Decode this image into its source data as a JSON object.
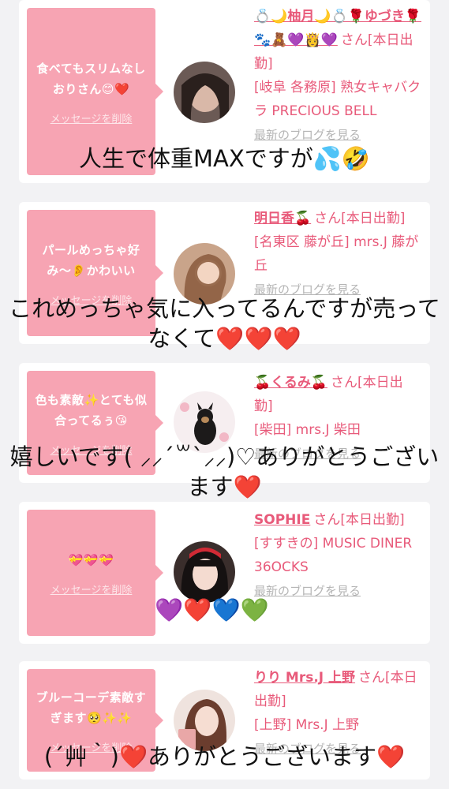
{
  "cards": [
    {
      "message": "食べてもスリムなしおりさん😊❤️",
      "delete_label": "メッセージを削除",
      "name": "💍🌙柚月🌙💍🌹ゆづき🌹🐾🧸💜👸💜",
      "suffix": "さん[本日出勤]",
      "shop": "[岐阜 各務原] 熟女キャバクラ PRECIOUS BELL",
      "blog_link": "最新のブログを見る"
    },
    {
      "message": "パールめっちゃ好み〜👂かわいい",
      "delete_label": "メッセージを削除",
      "name": "明日香🍒",
      "suffix": "さん[本日出勤]",
      "shop": "[名東区 藤が丘] mrs.J 藤が丘",
      "blog_link": "最新のブログを見る"
    },
    {
      "message": "色も素敵✨とても似合ってるぅ😘",
      "delete_label": "メッセージを削除",
      "name": "🍒くるみ🍒",
      "suffix": "さん[本日出勤]",
      "shop": "[柴田] mrs.J 柴田",
      "blog_link": "最新のブログを見る"
    },
    {
      "message": "💝💝💝",
      "delete_label": "メッセージを削除",
      "name": "SOPHIE",
      "suffix": "さん[本日出勤]",
      "shop": "[すすきの] MUSIC DINER 36OCKS",
      "blog_link": "最新のブログを見る"
    },
    {
      "message": "ブルーコーデ素敵すぎます🥺✨✨",
      "delete_label": "メッセージを削除",
      "name": "りり Mrs.J 上野",
      "suffix": "さん[本日出勤]",
      "shop": "[上野] Mrs.J 上野",
      "blog_link": "最新のブログを見る"
    }
  ],
  "captions": [
    "人生で体重MAXですが💦🤣",
    "これめっちゃ気に入ってるんですが売ってなくて❤️❤️❤️",
    "嬉しいです( ⸝⸝´꒳`⸝⸝)♡ありがとうございます❤️",
    "💜❤️💙💚",
    "(´艸｀)❤️ありがとうございます❤️"
  ],
  "colors": {
    "bubble": "#f7a4b3",
    "accent": "#e85a7a",
    "background": "#f2f2f4"
  }
}
